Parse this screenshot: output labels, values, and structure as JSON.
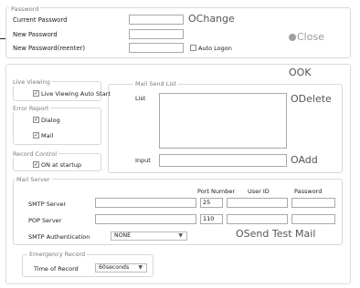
{
  "password": {
    "group_title": "Password",
    "current_label": "Current Password",
    "new_label": "New Password",
    "reenter_label": "New Password(reenter)",
    "current_value": "",
    "new_value": "",
    "reenter_value": "",
    "change_label": "Change",
    "auto_logon_label": "Auto Logon",
    "auto_logon_checked": false,
    "close_label": "Close"
  },
  "ok_label": "OK",
  "live_viewing": {
    "group_title": "Live Viewing",
    "auto_start_label": "Live Viewing Auto Start",
    "auto_start_checked": true
  },
  "error_report": {
    "group_title": "Error Report",
    "dialog_label": "Dialog",
    "dialog_checked": true,
    "mail_label": "Mail",
    "mail_checked": true
  },
  "record_control": {
    "group_title": "Record Control",
    "on_startup_label": "ON at startup",
    "on_startup_checked": true
  },
  "mail_send_list": {
    "group_title": "Mail Send List",
    "list_label": "List",
    "input_label": "Input",
    "input_value": "",
    "delete_label": "Delete",
    "add_label": "Add"
  },
  "mail_server": {
    "group_title": "Mail Server",
    "col_port": "Port Number",
    "col_user": "User ID",
    "col_password": "Password",
    "smtp_label": "SMTP Server",
    "smtp_value": "",
    "smtp_port": "25",
    "smtp_user": "",
    "smtp_password": "",
    "pop_label": "POP Server",
    "pop_value": "",
    "pop_port": "110",
    "pop_user": "",
    "pop_password": "",
    "auth_label": "SMTP Authentication",
    "auth_value": "NONE",
    "send_test_label": "Send Test Mail"
  },
  "emergency_record": {
    "group_title": "Emergency Record",
    "time_label": "Time of Record",
    "time_value": "60seconds"
  },
  "icons": {
    "button_circle": "circle-icon",
    "dropdown": "chevron-down-icon",
    "check": "checkmark-icon"
  }
}
